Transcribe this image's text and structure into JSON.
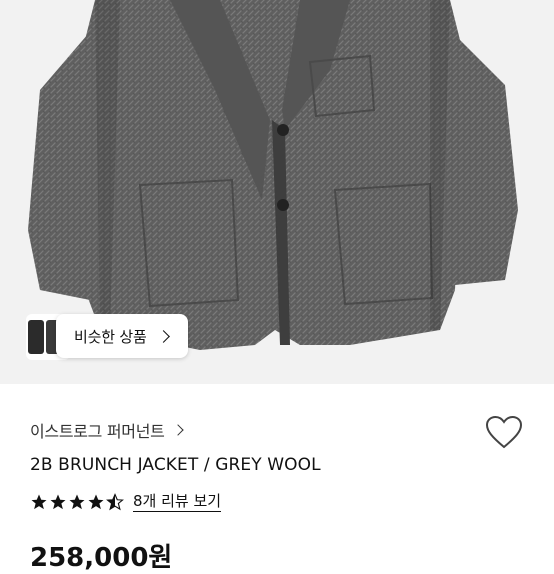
{
  "similar": {
    "label": "비슷한 상품"
  },
  "brand": {
    "name": "이스트로그 퍼머넌트"
  },
  "product": {
    "title": "2B BRUNCH JACKET / GREY WOOL",
    "price": "258,000원"
  },
  "rating": {
    "stars": 4.5,
    "review_link": "8개 리뷰 보기"
  },
  "icons": {
    "heart": "heart-icon",
    "star": "star-icon",
    "chevron": "chevron-right-icon"
  },
  "colors": {
    "jacket": "#5c5c5c",
    "background": "#f2f2f2",
    "text": "#111111"
  }
}
